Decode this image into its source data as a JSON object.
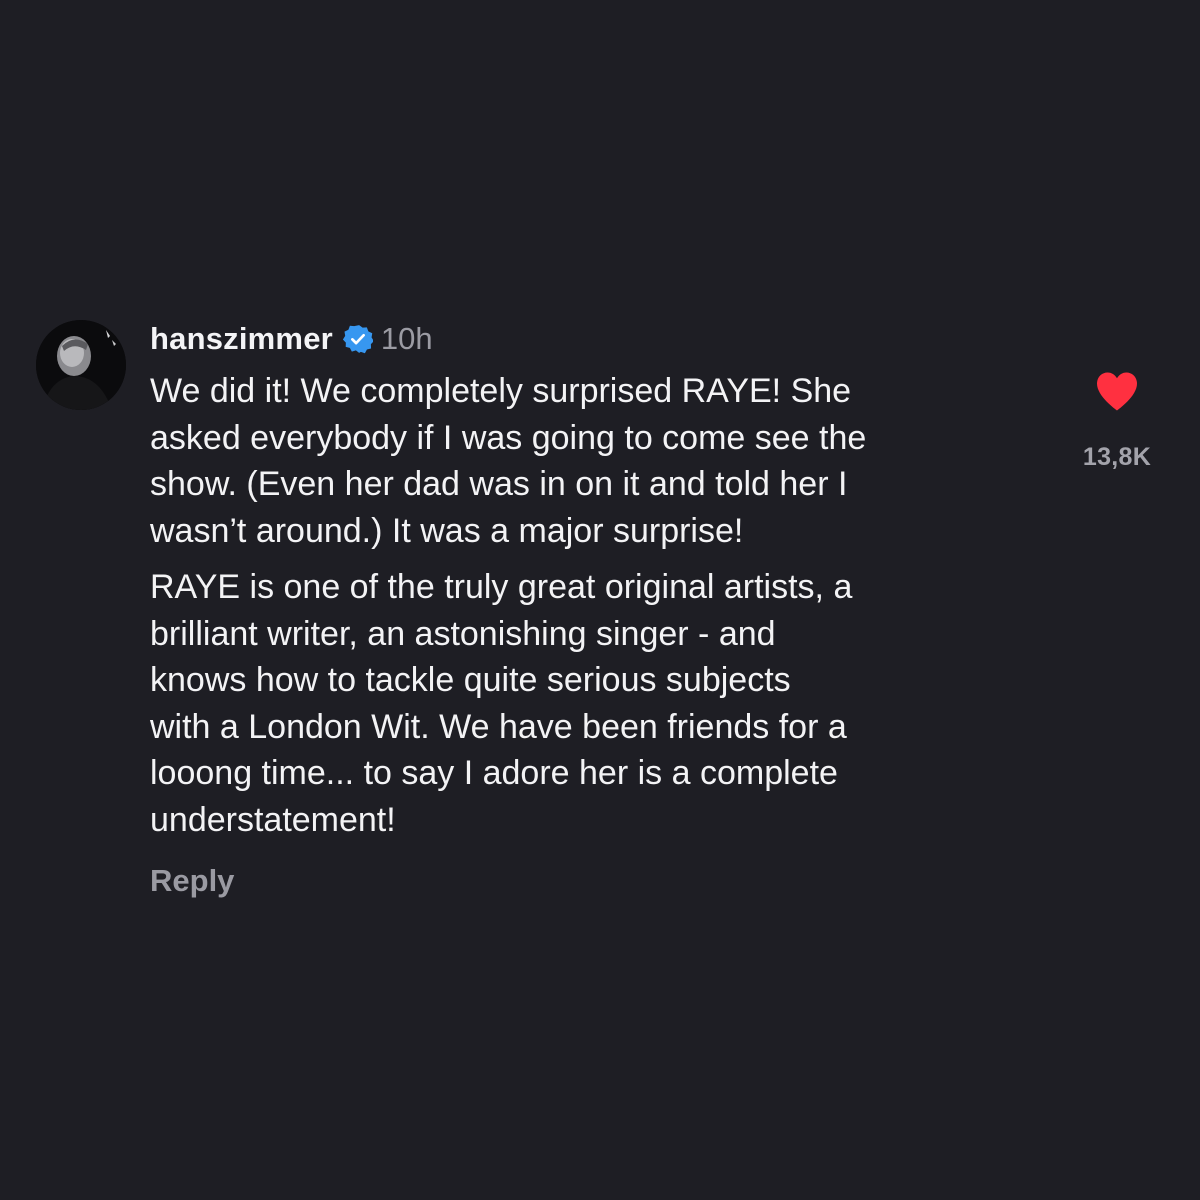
{
  "comment": {
    "username": "hanszimmer",
    "verified_icon": "verified-badge-icon",
    "timestamp": "10h",
    "paragraphs": [
      [
        "We did it! We completely surprised RAYE! She",
        "asked everybody if I was going to come see the",
        "show. (Even her dad was in on it and told her I",
        "wasn’t around.) It was a major surprise!"
      ],
      [
        "RAYE is one of the truly great original artists, a",
        "brilliant writer, an astonishing singer - and",
        "knows how to tackle quite serious subjects",
        "with a London Wit. We have been friends for a",
        "looong time... to say I adore her is a complete",
        "understatement!"
      ]
    ],
    "reply_label": "Reply",
    "like_icon": "heart-filled-icon",
    "like_count": "13,8K"
  },
  "colors": {
    "background": "#1e1e24",
    "text": "#f3f3f5",
    "secondary_text": "#9b9ba3",
    "verified_blue": "#3797f0",
    "like_red": "#ff3040"
  }
}
